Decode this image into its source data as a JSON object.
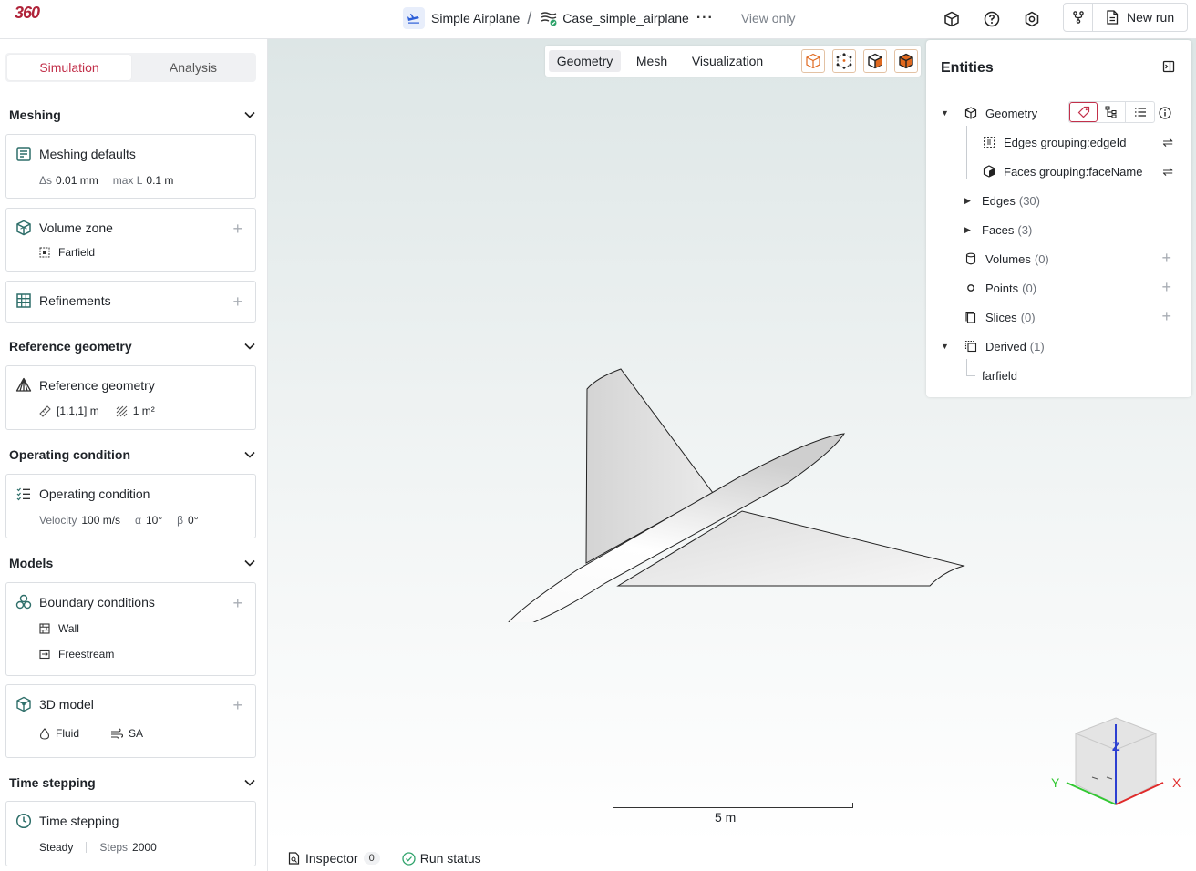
{
  "header": {
    "logo_text": "360",
    "project_name": "Simple Airplane",
    "separator": "/",
    "case_name": "Case_simple_airplane",
    "more_label": "···",
    "view_mode": "View only",
    "new_run_label": "New run"
  },
  "sidebar": {
    "tabs": [
      {
        "label": "Simulation",
        "active": true
      },
      {
        "label": "Analysis",
        "active": false
      }
    ],
    "sections": {
      "meshing": {
        "title": "Meshing",
        "defaults_title": "Meshing defaults",
        "ds_label": "Δs",
        "ds_value": "0.01 mm",
        "maxl_label": "max L",
        "maxl_value": "0.1 m",
        "volume_zone_title": "Volume zone",
        "volume_zone_item": "Farfield",
        "refinements_title": "Refinements"
      },
      "reference": {
        "title": "Reference geometry",
        "card_title": "Reference geometry",
        "length_value": "[1,1,1] m",
        "area_value": "1 m²"
      },
      "operating": {
        "title": "Operating condition",
        "card_title": "Operating condition",
        "velocity_label": "Velocity",
        "velocity_value": "100 m/s",
        "alpha_label": "α",
        "alpha_value": "10°",
        "beta_label": "β",
        "beta_value": "0°"
      },
      "models": {
        "title": "Models",
        "bc_title": "Boundary conditions",
        "bc_items": [
          "Wall",
          "Freestream"
        ],
        "model3d_title": "3D model",
        "fluid_label": "Fluid",
        "turb_label": "SA"
      },
      "time": {
        "title": "Time stepping",
        "card_title": "Time stepping",
        "mode": "Steady",
        "steps_label": "Steps",
        "steps_value": "2000"
      }
    }
  },
  "viewport": {
    "tabs": [
      {
        "label": "Geometry",
        "active": true
      },
      {
        "label": "Mesh",
        "active": false
      },
      {
        "label": "Visualization",
        "active": false
      }
    ],
    "scale_label": "5 m",
    "axes": {
      "x": "X",
      "y": "Y",
      "z": "Z"
    },
    "accent_color": "#e0691f"
  },
  "entities": {
    "title": "Entities",
    "geometry_label": "Geometry",
    "edges_grouping": "Edges grouping:edgeId",
    "faces_grouping": "Faces grouping:faceName",
    "edges_label": "Edges",
    "edges_count": "(30)",
    "faces_label": "Faces",
    "faces_count": "(3)",
    "volumes_label": "Volumes",
    "volumes_count": "(0)",
    "points_label": "Points",
    "points_count": "(0)",
    "slices_label": "Slices",
    "slices_count": "(0)",
    "derived_label": "Derived",
    "derived_count": "(1)",
    "derived_child": "farfield"
  },
  "footer": {
    "inspector_label": "Inspector",
    "inspector_count": "0",
    "run_status_label": "Run status"
  },
  "colors": {
    "brand": "#c2304a",
    "accent": "#e0691f",
    "success": "#2fa36b"
  }
}
